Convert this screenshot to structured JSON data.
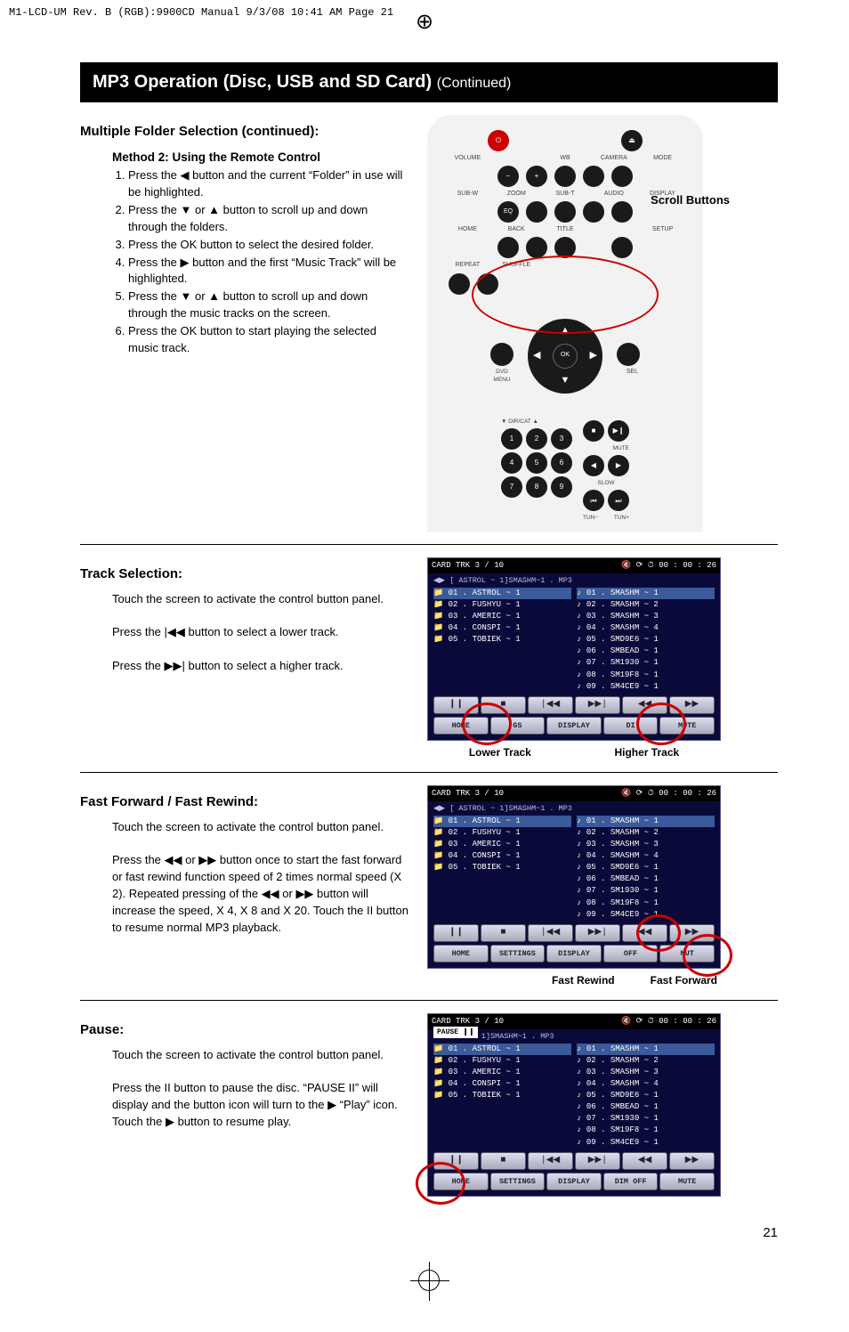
{
  "crop_header": "M1-LCD-UM Rev. B (RGB):9900CD Manual  9/3/08  10:41 AM  Page 21",
  "page_number": "21",
  "heading": {
    "title": "MP3 Operation (Disc, USB and SD Card)",
    "continued": "(Continued)"
  },
  "section1": {
    "title": "Multiple Folder Selection (continued):",
    "method_title": "Method 2: Using the Remote Control",
    "steps": [
      "Press the ◀ button and the current “Folder” in use will be highlighted.",
      "Press the ▼ or ▲ button to scroll up and down through the folders.",
      "Press the OK button to select the desired folder.",
      "Press the ▶ button and the first “Music Track” will be highlighted.",
      "Press the ▼ or ▲ button to scroll up and down through the music tracks on the screen.",
      "Press the OK button to start playing the selected music track."
    ],
    "callout_label": "Scroll Buttons"
  },
  "remote": {
    "top_labels": [
      "VOLUME",
      "",
      "WB",
      "CAMERA",
      "MODE"
    ],
    "row2_labels": [
      "SUB-W",
      "ZOOM",
      "SUB-T",
      "AUDIO",
      "DISPLAY"
    ],
    "row3_labels": [
      "HOME",
      "BACK",
      "TITLE",
      "",
      "SETUP"
    ],
    "row4_labels": [
      "REPEAT",
      "SHUFFLE",
      "",
      "",
      ""
    ],
    "dvd_menu": "DVD MENU",
    "ok": "OK",
    "sel": "SEL",
    "dir_cat": "DIR/CAT",
    "mute": "MUTE",
    "slow": "SLOW",
    "tun_minus": "TUN−",
    "tun_plus": "TUN+",
    "num_rows": [
      [
        "1",
        "2",
        "3"
      ],
      [
        "4",
        "5",
        "6"
      ],
      [
        "7",
        "8",
        "9"
      ]
    ]
  },
  "section2": {
    "title": "Track Selection:",
    "p1": "Touch the screen to activate the control button panel.",
    "p2": "Press the |◀◀ button to select a lower track.",
    "p3": "Press the ▶▶| button to select a higher track.",
    "lower_label": "Lower Track",
    "higher_label": "Higher Track"
  },
  "osd_header": {
    "left": "CARD   TRK   3 / 10",
    "right": "00 : 00 : 26",
    "sub": "[ ASTROL ~ 1]SMASHM~1 . MP3"
  },
  "osd_left_list": [
    "01 . ASTROL ~ 1",
    "02 . FUSHYU ~ 1",
    "03 . AMERIC ~ 1",
    "04 . CONSPI ~ 1",
    "05 . TOBIEK ~ 1"
  ],
  "osd_right_list_a": [
    "01 . SMASHM ~ 1",
    "02 . SMASHM ~ 2",
    "03 . SMASHM ~ 3",
    "04 . SMASHM ~ 4",
    "05 . SMD9E6 ~ 1",
    "06 . SMBEAD ~ 1",
    "07 . SM1930 ~ 1",
    "08 . SM19F8 ~ 1",
    "09 . SM4CE9 ~ 1"
  ],
  "osd_controls": [
    "❙❙",
    "■",
    "|◀◀",
    "▶▶|",
    "◀◀",
    "▶▶"
  ],
  "osd_menu_row": [
    "HOME",
    "SETTINGS",
    "DISPLAY",
    "DIM OFF",
    "MUTE"
  ],
  "osd_menu_row_trk": [
    "HOME",
    "GS",
    "DISPLAY",
    "DI",
    "MUTE"
  ],
  "section3": {
    "title": "Fast Forward / Fast Rewind:",
    "p1": "Touch the screen to activate the control button panel.",
    "p2": "Press the ◀◀ or ▶▶ button once to start the fast forward or fast rewind function speed of 2 times normal speed (X 2). Repeated pressing of the ◀◀ or ▶▶ button will increase the speed, X 4, X 8 and X 20. Touch the II button to resume normal MP3 playback.",
    "rewind_label": "Fast Rewind",
    "forward_label": "Fast Forward"
  },
  "section4": {
    "title": "Pause:",
    "p1": "Touch the screen to activate the control button panel.",
    "p2": "Press the II button to pause the disc. “PAUSE II” will display and the button icon will turn to the ▶ “Play” icon. Touch the ▶ button to resume play.",
    "pause_badge": "PAUSE  ❙❙"
  }
}
